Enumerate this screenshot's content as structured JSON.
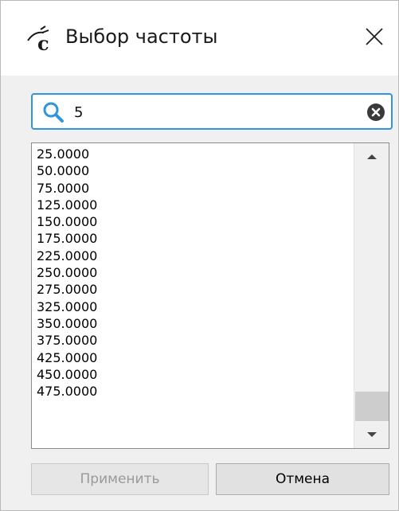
{
  "window": {
    "title": "Выбор частоты"
  },
  "search": {
    "value": "5",
    "placeholder": ""
  },
  "frequencies": [
    "25.0000",
    "50.0000",
    "75.0000",
    "125.0000",
    "150.0000",
    "175.0000",
    "225.0000",
    "250.0000",
    "275.0000",
    "325.0000",
    "350.0000",
    "375.0000",
    "425.0000",
    "450.0000",
    "475.0000"
  ],
  "buttons": {
    "apply": "Применить",
    "cancel": "Отмена"
  },
  "colors": {
    "accent": "#2f95dc",
    "disabled_text": "#9a9a9a"
  },
  "icons": {
    "app": "program-logo-icon",
    "close": "close-icon",
    "search": "search-icon",
    "clear": "clear-icon",
    "scroll_up": "scroll-up-arrow-icon",
    "scroll_down": "scroll-down-arrow-icon"
  }
}
